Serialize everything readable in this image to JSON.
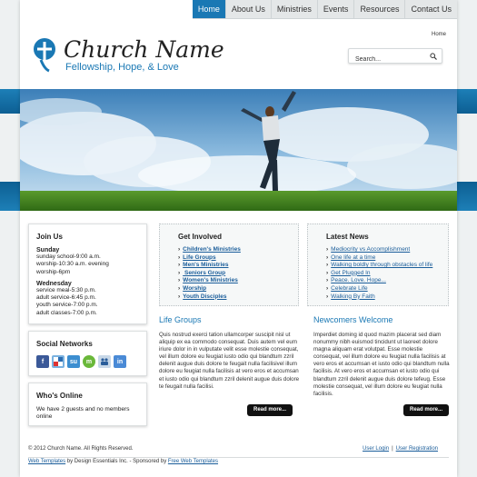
{
  "nav": {
    "items": [
      {
        "label": "Home",
        "active": true
      },
      {
        "label": "About Us"
      },
      {
        "label": "Ministries"
      },
      {
        "label": "Events"
      },
      {
        "label": "Resources"
      },
      {
        "label": "Contact Us"
      }
    ]
  },
  "breadcrumb": "Home",
  "logo": {
    "name": "Church Name",
    "tagline": "Fellowship, Hope, & Love"
  },
  "search": {
    "placeholder": "Search..."
  },
  "join_us": {
    "title": "Join Us",
    "sunday": {
      "title": "Sunday",
      "lines": [
        "sunday school-9:00 a.m.",
        "worship-10:30 a.m. evening",
        "worship-6pm"
      ]
    },
    "wednesday": {
      "title": "Wednesday",
      "lines": [
        "service meal-5:30 p.m.",
        "adult service-6:45 p.m.",
        "youth service-7:00 p.m.",
        "adult classes-7:00 p.m."
      ]
    }
  },
  "social": {
    "title": "Social Networks",
    "icons": [
      "facebook-icon",
      "delicious-icon",
      "stumbleupon-icon",
      "mixx-icon",
      "myspace-icon",
      "linkedin-icon"
    ]
  },
  "whos_online": {
    "title": "Who's Online",
    "lines": [
      "We have 2 guests and no members",
      "online"
    ]
  },
  "get_involved": {
    "title": "Get Involved",
    "links": [
      "Children's Ministries",
      "Life Groups",
      "Men's Ministries",
      " Seniors Group",
      "Women's Ministries",
      "Worship",
      "Youth Disciples"
    ]
  },
  "latest_news": {
    "title": "Latest News",
    "links": [
      "Mediocrity vs Accomplishment",
      "One life at a time",
      "Walking boldly through obstacles of life",
      "Get Plugged In",
      "Peace. Love. Hope...",
      "Celebrate Life",
      "Walking By Faith"
    ]
  },
  "life_groups": {
    "title": "Life Groups",
    "body": "Quis nostrud exerci tation ullamcorper suscipit nisl ut aliquip ex ea commodo consequat. Duis autem vel eum iriure dolor in in vulputate velit esse molestie consequat, vel illum dolore eu feugiat iusto odio qui blandtum zzril delenit augue duis dolore te feugait nulla facilisivel illum dolore eu feugiat nulla facilisis at vero eros et accumsan et iusto odio qui blandtum zzril delenit augue duis dolore te feugait nulla facilisi.",
    "button": "Read more..."
  },
  "newcomers": {
    "title": "Newcomers Welcome",
    "body": "Imperdiet doming id quod mazim placerat sed diam nonummy nibh euismod tincidunt ut laoreet dolore magna aliquam erat volutpat. Esse molestie consequat, vel illum dolore eu feugiat nulla facilisis at vero eros et accumsan et iusto odio qui blandtum nulla facilisis. At vero eros et accumsan et iusto odio qui blandtum zzril delenit augue duis dolore tefeug. Esse molestie consequat, vel illum dolore eu feugiat nulla facilisis.",
    "button": "Read more..."
  },
  "footer": {
    "copyright": "© 2012 Church Name. All Rights Reserved.",
    "links": [
      "User Login",
      "User Registration"
    ],
    "separator": "|",
    "credit_link1": "Web Templates",
    "credit_middle": " by Design Essentials Inc. - Sponsored by ",
    "credit_link2": "Free Web Templates"
  },
  "colors": {
    "accent": "#1a78b4",
    "link": "#1a5d9a",
    "button": "#111111"
  }
}
